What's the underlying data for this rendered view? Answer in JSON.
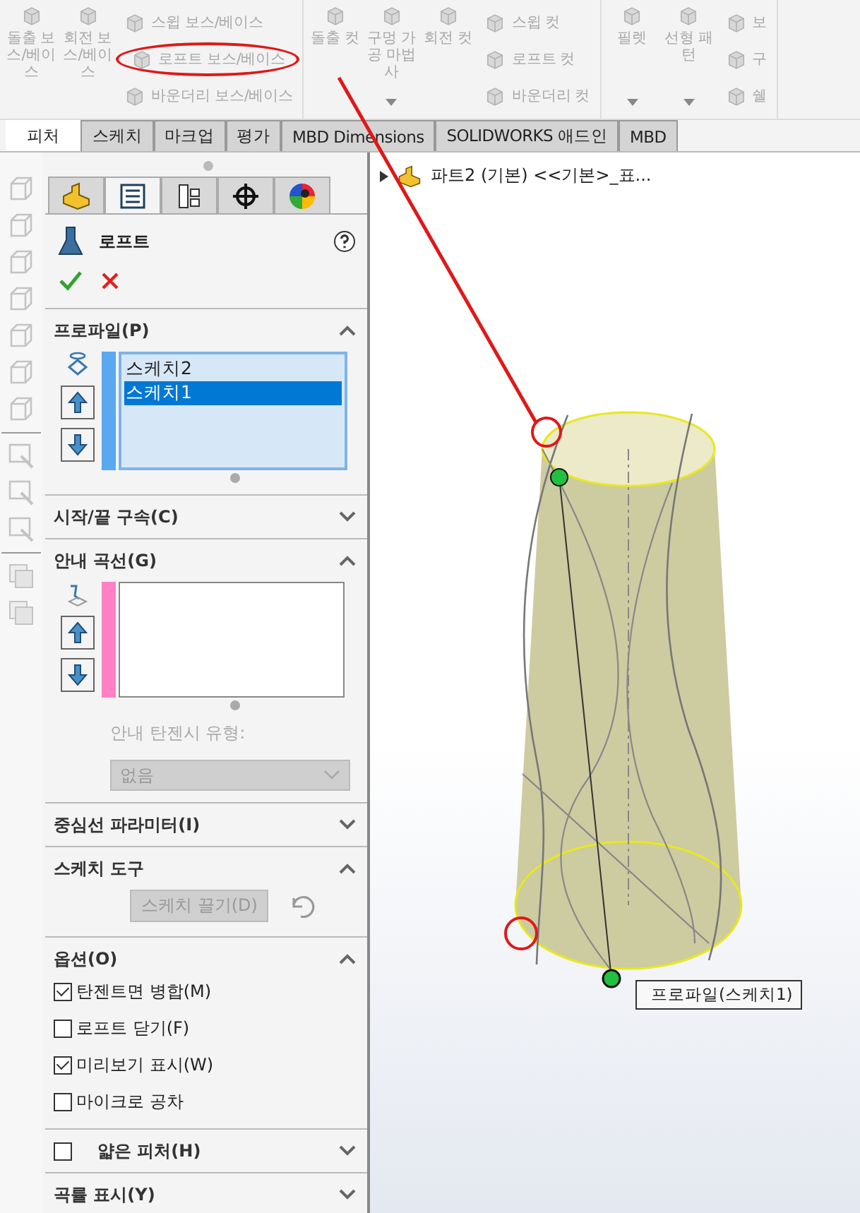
{
  "ribbon": {
    "disabled": true,
    "groups": [
      {
        "large": [
          {
            "label": "돌출 보스/베이스",
            "has_menu": false
          },
          {
            "label": "회전 보스/베이스",
            "has_menu": false
          }
        ],
        "small": [
          {
            "label": "스윕 보스/베이스",
            "circled": false
          },
          {
            "label": "로프트 보스/베이스",
            "circled": true
          },
          {
            "label": "바운더리 보스/베이스",
            "circled": false
          }
        ]
      },
      {
        "large": [
          {
            "label": "돌출 컷",
            "has_menu": false
          },
          {
            "label": "구멍 가공 마법사",
            "has_menu": true
          },
          {
            "label": "회전 컷",
            "has_menu": false
          }
        ],
        "small": [
          {
            "label": "스윕 컷",
            "circled": false
          },
          {
            "label": "로프트 컷",
            "circled": false
          },
          {
            "label": "바운더리 컷",
            "circled": false
          }
        ]
      },
      {
        "large": [
          {
            "label": "필렛",
            "has_menu": true
          },
          {
            "label": "선형 패턴",
            "has_menu": true
          }
        ],
        "small": [
          {
            "label": "보",
            "circled": false
          },
          {
            "label": "구",
            "circled": false
          },
          {
            "label": "쉘",
            "circled": false
          }
        ]
      }
    ]
  },
  "tabs": [
    {
      "label": "피처",
      "selected": true
    },
    {
      "label": "스케치",
      "selected": false
    },
    {
      "label": "마크업",
      "selected": false
    },
    {
      "label": "평가",
      "selected": false
    },
    {
      "label": "MBD Dimensions",
      "selected": false
    },
    {
      "label": "SOLIDWORKS 애드인",
      "selected": false
    },
    {
      "label": "MBD",
      "selected": false
    }
  ],
  "pm_tabs": [
    {
      "kind": "feature",
      "selected": false
    },
    {
      "kind": "property",
      "selected": true
    },
    {
      "kind": "config",
      "selected": false
    },
    {
      "kind": "dimxpert",
      "selected": false
    },
    {
      "kind": "appearance",
      "selected": false
    }
  ],
  "feature": {
    "title": "로프트"
  },
  "sections": [
    {
      "kind": "profiles",
      "title": "프로파일(P)",
      "expanded": true,
      "color": "#5aa8f0",
      "items": [
        {
          "label": "스케치2",
          "selected": false
        },
        {
          "label": "스케치1",
          "selected": true
        }
      ]
    },
    {
      "kind": "plain",
      "title": "시작/끝 구속(C)",
      "expanded": false
    },
    {
      "kind": "guides",
      "title": "안내 곡선(G)",
      "expanded": true,
      "color": "#ff80c4",
      "field_label": "안내 탄젠시 유형:",
      "dropdown": {
        "value": "없음",
        "disabled": true
      }
    },
    {
      "kind": "plain",
      "title": "중심선 파라미터(I)",
      "expanded": false
    },
    {
      "kind": "tools",
      "title": "스케치 도구",
      "expanded": true,
      "button": {
        "label": "스케치 끌기(D)",
        "disabled": true
      }
    },
    {
      "kind": "options",
      "title": "옵션(O)",
      "expanded": true,
      "checkboxes": [
        {
          "label": "탄젠트면 병합(M)",
          "checked": true
        },
        {
          "label": "로프트 닫기(F)",
          "checked": false
        },
        {
          "label": "미리보기 표시(W)",
          "checked": true
        },
        {
          "label": "마이크로 공차",
          "checked": false
        }
      ]
    },
    {
      "kind": "checked_header",
      "title": "얇은 피처(H)",
      "expanded": false,
      "checked": false
    },
    {
      "kind": "plain",
      "title": "곡률 표시(Y)",
      "expanded": false
    }
  ],
  "tree": {
    "label": "파트2 (기본) <<기본>_표...",
    "expanded": false
  },
  "callout": "프로파일(스케치1)"
}
